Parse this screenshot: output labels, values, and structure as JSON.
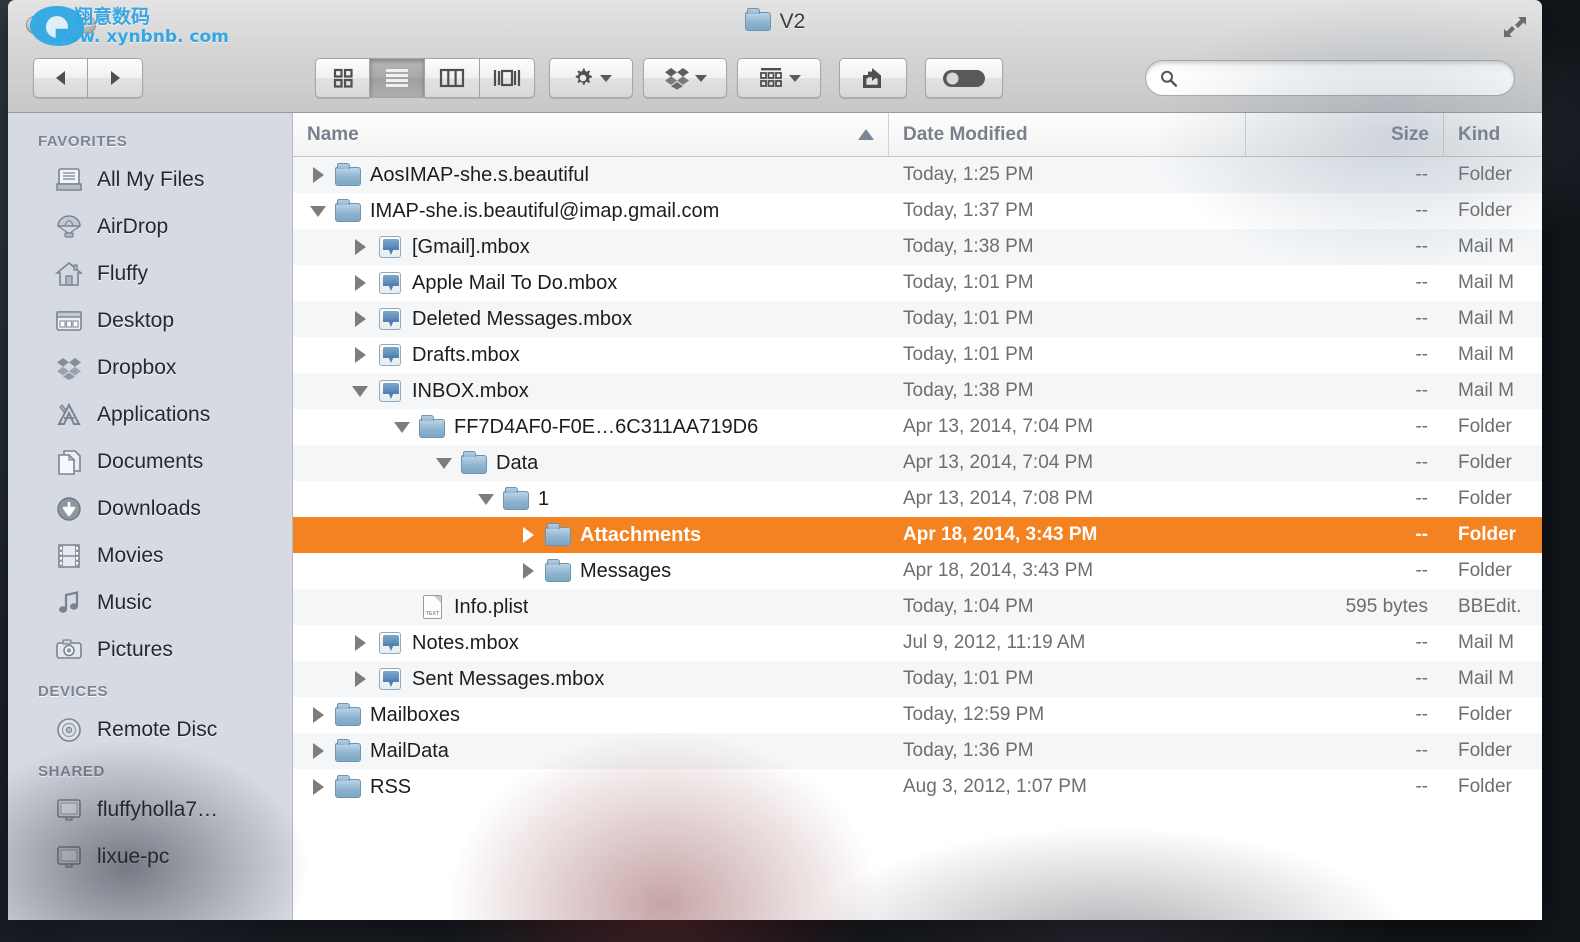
{
  "window": {
    "title": "V2",
    "title_icon": "folder-icon",
    "fullscreen_icon": "fullscreen-arrows-icon",
    "traffic_lights": [
      "close-button",
      "minimize-button",
      "zoom-button"
    ]
  },
  "toolbar": {
    "back_label": "◀",
    "forward_label": "▶",
    "view_modes": [
      {
        "name": "icon-view",
        "icon": "grid-icon",
        "active": false
      },
      {
        "name": "list-view",
        "icon": "list-lines-icon",
        "active": true
      },
      {
        "name": "column-view",
        "icon": "columns-icon",
        "active": false
      },
      {
        "name": "coverflow-view",
        "icon": "coverflow-icon",
        "active": false
      }
    ],
    "action_label": "gear-icon",
    "dropbox_label": "dropbox-icon",
    "arrange_label": "arrange-grid-icon",
    "share_label": "share-arrow-icon",
    "tag_label": "tag-toggle-icon"
  },
  "search": {
    "value": "",
    "placeholder": "",
    "icon": "search-icon"
  },
  "sidebar": {
    "sections": [
      {
        "header": "FAVORITES",
        "items": [
          {
            "label": "All My Files",
            "icon": "all-my-files-icon"
          },
          {
            "label": "AirDrop",
            "icon": "airdrop-parachute-icon"
          },
          {
            "label": "Fluffy",
            "icon": "home-icon"
          },
          {
            "label": "Desktop",
            "icon": "desktop-icon"
          },
          {
            "label": "Dropbox",
            "icon": "dropbox-icon"
          },
          {
            "label": "Applications",
            "icon": "applications-icon"
          },
          {
            "label": "Documents",
            "icon": "documents-icon"
          },
          {
            "label": "Downloads",
            "icon": "downloads-arrow-icon"
          },
          {
            "label": "Movies",
            "icon": "film-strip-icon"
          },
          {
            "label": "Music",
            "icon": "music-note-icon"
          },
          {
            "label": "Pictures",
            "icon": "camera-icon"
          }
        ]
      },
      {
        "header": "DEVICES",
        "items": [
          {
            "label": "Remote Disc",
            "icon": "optical-disc-icon"
          }
        ]
      },
      {
        "header": "SHARED",
        "items": [
          {
            "label": "fluffyholla7…",
            "icon": "computer-display-icon"
          },
          {
            "label": "lixue-pc",
            "icon": "computer-display-icon"
          }
        ]
      }
    ]
  },
  "filelist": {
    "columns": [
      {
        "label": "Name",
        "sorted": true,
        "sort_direction": "ascending"
      },
      {
        "label": "Date Modified",
        "sorted": false
      },
      {
        "label": "Size",
        "sorted": false
      },
      {
        "label": "Kind",
        "sorted": false
      }
    ],
    "rows": [
      {
        "name": "AosIMAP-she.s.beautiful",
        "date": "Today, 1:25 PM",
        "size": "--",
        "kind": "Folder",
        "depth": 0,
        "icon": "folder-icon",
        "twisty": "right",
        "selected": false
      },
      {
        "name": "IMAP-she.is.beautiful@imap.gmail.com",
        "date": "Today, 1:37 PM",
        "size": "--",
        "kind": "Folder",
        "depth": 0,
        "icon": "folder-icon",
        "twisty": "down",
        "selected": false
      },
      {
        "name": "[Gmail].mbox",
        "date": "Today, 1:38 PM",
        "size": "--",
        "kind": "Mail M",
        "depth": 1,
        "icon": "mailbox-icon",
        "twisty": "right",
        "selected": false
      },
      {
        "name": "Apple Mail To Do.mbox",
        "date": "Today, 1:01 PM",
        "size": "--",
        "kind": "Mail M",
        "depth": 1,
        "icon": "mailbox-icon",
        "twisty": "right",
        "selected": false
      },
      {
        "name": "Deleted Messages.mbox",
        "date": "Today, 1:01 PM",
        "size": "--",
        "kind": "Mail M",
        "depth": 1,
        "icon": "mailbox-icon",
        "twisty": "right",
        "selected": false
      },
      {
        "name": "Drafts.mbox",
        "date": "Today, 1:01 PM",
        "size": "--",
        "kind": "Mail M",
        "depth": 1,
        "icon": "mailbox-icon",
        "twisty": "right",
        "selected": false
      },
      {
        "name": "INBOX.mbox",
        "date": "Today, 1:38 PM",
        "size": "--",
        "kind": "Mail M",
        "depth": 1,
        "icon": "mailbox-icon",
        "twisty": "down",
        "selected": false
      },
      {
        "name": "FF7D4AF0-F0E…6C311AA719D6",
        "date": "Apr 13, 2014, 7:04 PM",
        "size": "--",
        "kind": "Folder",
        "depth": 2,
        "icon": "folder-icon",
        "twisty": "down",
        "selected": false
      },
      {
        "name": "Data",
        "date": "Apr 13, 2014, 7:04 PM",
        "size": "--",
        "kind": "Folder",
        "depth": 3,
        "icon": "folder-icon",
        "twisty": "down",
        "selected": false
      },
      {
        "name": "1",
        "date": "Apr 13, 2014, 7:08 PM",
        "size": "--",
        "kind": "Folder",
        "depth": 4,
        "icon": "folder-icon",
        "twisty": "down",
        "selected": false
      },
      {
        "name": "Attachments",
        "date": "Apr 18, 2014, 3:43 PM",
        "size": "--",
        "kind": "Folder",
        "depth": 5,
        "icon": "folder-icon",
        "twisty": "right",
        "selected": true
      },
      {
        "name": "Messages",
        "date": "Apr 18, 2014, 3:43 PM",
        "size": "--",
        "kind": "Folder",
        "depth": 5,
        "icon": "folder-icon",
        "twisty": "right",
        "selected": false
      },
      {
        "name": "Info.plist",
        "date": "Today, 1:04 PM",
        "size": "595 bytes",
        "kind": "BBEdit.",
        "depth": 2,
        "icon": "text-document-icon",
        "twisty": "none",
        "selected": false
      },
      {
        "name": "Notes.mbox",
        "date": "Jul 9, 2012, 11:19 AM",
        "size": "--",
        "kind": "Mail M",
        "depth": 1,
        "icon": "mailbox-icon",
        "twisty": "right",
        "selected": false
      },
      {
        "name": "Sent Messages.mbox",
        "date": "Today, 1:01 PM",
        "size": "--",
        "kind": "Mail M",
        "depth": 1,
        "icon": "mailbox-icon",
        "twisty": "right",
        "selected": false
      },
      {
        "name": "Mailboxes",
        "date": "Today, 12:59 PM",
        "size": "--",
        "kind": "Folder",
        "depth": 0,
        "icon": "folder-icon",
        "twisty": "right",
        "selected": false
      },
      {
        "name": "MailData",
        "date": "Today, 1:36 PM",
        "size": "--",
        "kind": "Folder",
        "depth": 0,
        "icon": "folder-icon",
        "twisty": "right",
        "selected": false
      },
      {
        "name": "RSS",
        "date": "Aug 3, 2012, 1:07 PM",
        "size": "--",
        "kind": "Folder",
        "depth": 0,
        "icon": "folder-icon",
        "twisty": "right",
        "selected": false
      }
    ]
  },
  "watermark": {
    "chinese": "翔意数码",
    "url": "www. xynbnb. com"
  },
  "colors": {
    "selection": "#f58220",
    "sidebar_bg": "#d6dbe3",
    "header_text": "#78808e",
    "watermark": "#33a6e3"
  }
}
